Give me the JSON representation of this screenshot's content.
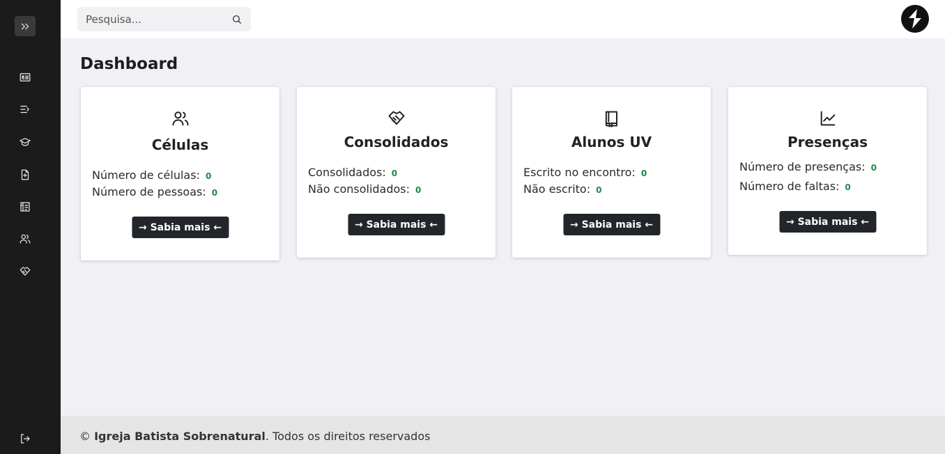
{
  "header": {
    "search_placeholder": "Pesquisa..."
  },
  "page": {
    "title": "Dashboard"
  },
  "cards": [
    {
      "title": "Células",
      "stats": [
        {
          "label": "Número de células:",
          "value": "0"
        },
        {
          "label": "Número de pessoas:",
          "value": "0"
        }
      ],
      "button": "→ Sabia mais ←"
    },
    {
      "title": "Consolidados",
      "stats": [
        {
          "label": "Consolidados:",
          "value": "0"
        },
        {
          "label": "Não consolidados:",
          "value": "0"
        }
      ],
      "button": "→ Sabia mais ←"
    },
    {
      "title": "Alunos UV",
      "stats": [
        {
          "label": "Escrito no encontro:",
          "value": "0"
        },
        {
          "label": "Não escrito:",
          "value": "0"
        }
      ],
      "button": "→ Sabia mais ←"
    },
    {
      "title": "Presenças",
      "stats": [
        {
          "label": "Número de presenças:",
          "value": "0"
        },
        {
          "label": "Número de faltas:",
          "value": "0"
        }
      ],
      "button": "→ Sabia mais ←"
    }
  ],
  "footer": {
    "copyright": "©",
    "organization": "Igreja Batista Sobrenatural",
    "rights": ". Todos os direitos reservados"
  },
  "colors": {
    "sidebar": "#1b1b1b",
    "accent_value": "#1d8a4a",
    "button": "#22262b"
  }
}
